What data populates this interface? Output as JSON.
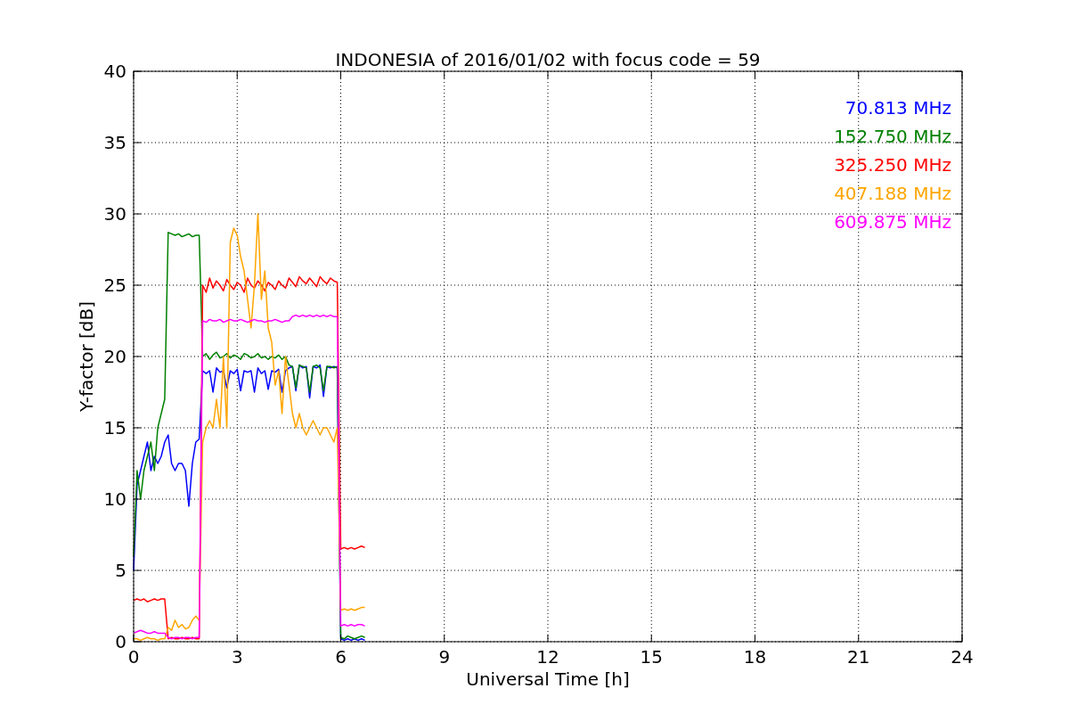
{
  "figure": {
    "chart_data": {
      "type": "line",
      "title": "INDONESIA of 2016/01/02 with focus code = 59",
      "xlabel": "Universal Time [h]",
      "ylabel": "Y-factor [dB]",
      "x": [
        0,
        0.1,
        0.2,
        0.3,
        0.4,
        0.5,
        0.6,
        0.7,
        0.8,
        0.9,
        1,
        1.1,
        1.2,
        1.3,
        1.4,
        1.5,
        1.6,
        1.7,
        1.8,
        1.9,
        2,
        2.1,
        2.2,
        2.3,
        2.4,
        2.5,
        2.6,
        2.7,
        2.8,
        2.9,
        3,
        3.1,
        3.2,
        3.3,
        3.4,
        3.5,
        3.6,
        3.7,
        3.8,
        3.9,
        4,
        4.1,
        4.2,
        4.3,
        4.4,
        4.5,
        4.6,
        4.7,
        4.8,
        4.9,
        5,
        5.1,
        5.2,
        5.3,
        5.4,
        5.5,
        5.6,
        5.7,
        5.8,
        5.9,
        6,
        6.1,
        6.2,
        6.3,
        6.4,
        6.5,
        6.6,
        6.7
      ],
      "series": [
        {
          "name": "70.813 MHz",
          "color": "#0000ff",
          "values": [
            5,
            11,
            12,
            13,
            14,
            12,
            13,
            12.5,
            13,
            14,
            14.5,
            12.5,
            12,
            12.5,
            12.5,
            12,
            9.5,
            12.5,
            14,
            14.2,
            19,
            18.8,
            19,
            17.5,
            19.2,
            18.9,
            19,
            17.8,
            19,
            18.8,
            19.1,
            17.6,
            19,
            18.9,
            19,
            17.5,
            19.2,
            18.8,
            19,
            17.7,
            19,
            18.9,
            19.1,
            17.5,
            19,
            19.2,
            19.3,
            17.6,
            19.4,
            19.2,
            19.3,
            17.1,
            19.3,
            19.2,
            19.4,
            17.2,
            19.3,
            19.2,
            19.3,
            19.2,
            0.2,
            0.1,
            0.2,
            0.1,
            0.2,
            0.1,
            0.2,
            0.1
          ]
        },
        {
          "name": "152.750 MHz",
          "color": "#008000",
          "values": [
            6,
            12,
            10,
            12,
            13,
            14,
            12,
            15,
            16,
            17,
            28.7,
            28.6,
            28.5,
            28.6,
            28.4,
            28.5,
            28.6,
            28.4,
            28.5,
            28.5,
            20,
            20.2,
            19.8,
            20.1,
            20.3,
            19.9,
            20,
            20.2,
            19.9,
            20.1,
            20,
            19.8,
            20.2,
            20.1,
            19.9,
            20,
            20.2,
            19.9,
            20,
            19.8,
            20,
            19.9,
            20.1,
            19.8,
            20,
            19.4,
            19.3,
            17.8,
            19.4,
            19.3,
            19.2,
            17.5,
            19.3,
            19.4,
            19.2,
            17.6,
            19.3,
            19.3,
            19.2,
            19.3,
            0.3,
            0.2,
            0.4,
            0.3,
            0.2,
            0.3,
            0.4,
            0.3
          ]
        },
        {
          "name": "325.250 MHz",
          "color": "#ff0000",
          "values": [
            2.9,
            3,
            2.9,
            3,
            2.8,
            2.9,
            3,
            2.9,
            3,
            3,
            0.2,
            0.3,
            0.2,
            0.2,
            0.3,
            0.2,
            0.2,
            0.3,
            0.2,
            0.2,
            25,
            24.5,
            25.5,
            24.8,
            25.3,
            25,
            24.6,
            25.4,
            25,
            24.7,
            25.2,
            25,
            24.5,
            25.5,
            25,
            24.8,
            25.3,
            25,
            24.6,
            25.2,
            25,
            24.7,
            25.3,
            25,
            24.8,
            25.5,
            25.2,
            24.9,
            25.6,
            25.3,
            25.1,
            25.5,
            25.2,
            24.9,
            25.6,
            25.3,
            25.1,
            25.5,
            25.3,
            25.2,
            6.5,
            6.6,
            6.5,
            6.6,
            6.5,
            6.6,
            6.7,
            6.6
          ]
        },
        {
          "name": "407.188 MHz",
          "color": "#ffa500",
          "values": [
            0.2,
            0.2,
            0.1,
            0.2,
            0.3,
            0.2,
            0.2,
            0.1,
            0.2,
            0.2,
            1,
            0.8,
            1.5,
            1,
            1.2,
            0.9,
            1,
            1.5,
            1.8,
            1.5,
            14,
            15,
            15.5,
            15,
            17,
            15,
            20,
            15,
            28,
            29,
            28.5,
            27,
            26,
            24,
            22,
            25,
            30,
            24,
            26,
            22,
            21,
            18,
            19,
            16,
            20,
            18,
            16,
            15,
            16,
            15,
            14.5,
            15,
            15.5,
            15,
            14.5,
            15,
            15,
            14.5,
            14,
            15,
            2.2,
            2.3,
            2.2,
            2.3,
            2.2,
            2.3,
            2.4,
            2.4
          ]
        },
        {
          "name": "609.875 MHz",
          "color": "#ff00ff",
          "values": [
            0.6,
            0.7,
            0.8,
            0.7,
            0.6,
            0.6,
            0.7,
            0.6,
            0.6,
            0.6,
            0.3,
            0.2,
            0.3,
            0.3,
            0.2,
            0.3,
            0.3,
            0.2,
            0.3,
            0.3,
            22.5,
            22.4,
            22.6,
            22.5,
            22.5,
            22.6,
            22.4,
            22.5,
            22.6,
            22.5,
            22.5,
            22.6,
            22.5,
            22.4,
            22.5,
            22.6,
            22.5,
            22.5,
            22.4,
            22.5,
            22.5,
            22.6,
            22.5,
            22.4,
            22.5,
            22.5,
            22.8,
            22.9,
            22.8,
            22.9,
            22.8,
            22.9,
            22.8,
            22.9,
            22.8,
            22.9,
            22.8,
            22.9,
            22.8,
            22.8,
            1.1,
            1.2,
            1.1,
            1.2,
            1.1,
            1.2,
            1.2,
            1.1
          ]
        }
      ],
      "grid": true,
      "xlim": [
        0,
        24
      ],
      "ylim": [
        0,
        40
      ],
      "xticks": [
        0,
        3,
        6,
        9,
        12,
        15,
        18,
        21,
        24
      ],
      "yticks": [
        0,
        5,
        10,
        15,
        20,
        25,
        30,
        35,
        40
      ]
    }
  }
}
